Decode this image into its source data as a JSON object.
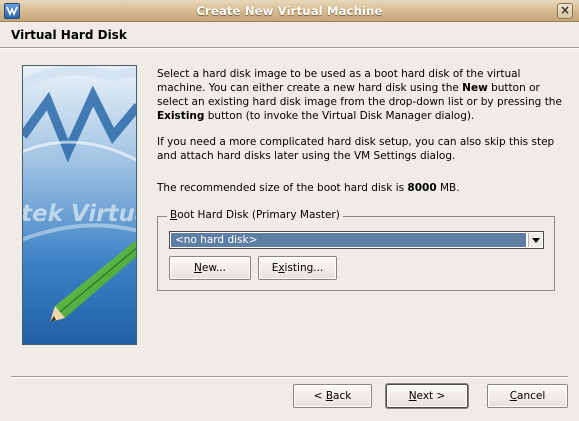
{
  "window": {
    "title": "Create New Virtual Machine",
    "icon": "virtualbox-app-icon",
    "close_label": "×"
  },
  "page": {
    "title": "Virtual Hard Disk"
  },
  "side_image": {
    "text": "tek Virtua",
    "icon": "pencil-illustration"
  },
  "description": {
    "p1": {
      "t1": "Select a hard disk image to be used as a boot hard disk of the virtual machine. You can either create a new hard disk using the ",
      "b1": "New",
      "t2": " button or select an existing hard disk image from the drop-down list or by pressing the ",
      "b2": "Existing",
      "t3": " button (to invoke the Virtual Disk Manager dialog)."
    },
    "p2": "If you need a more complicated hard disk setup, you can also skip this step and attach hard disks later using the VM Settings dialog.",
    "p3": {
      "t1": "The recommended size of the boot hard disk is ",
      "size": "8000",
      "t2": " MB."
    }
  },
  "boot_disk_group": {
    "legend_mnemonic": "B",
    "legend_rest": "oot Hard Disk (Primary Master)",
    "selected_disk": "<no hard disk>",
    "new_button": {
      "mnemonic": "N",
      "rest": "ew..."
    },
    "existing_button": {
      "mnemonic": "x",
      "pre": "E",
      "rest": "isting..."
    }
  },
  "footer": {
    "back": {
      "pre": "< ",
      "mnemonic": "B",
      "rest": "ack"
    },
    "next": {
      "mnemonic": "N",
      "rest": "ext >"
    },
    "cancel": {
      "mnemonic": "C",
      "rest": "ancel"
    }
  }
}
